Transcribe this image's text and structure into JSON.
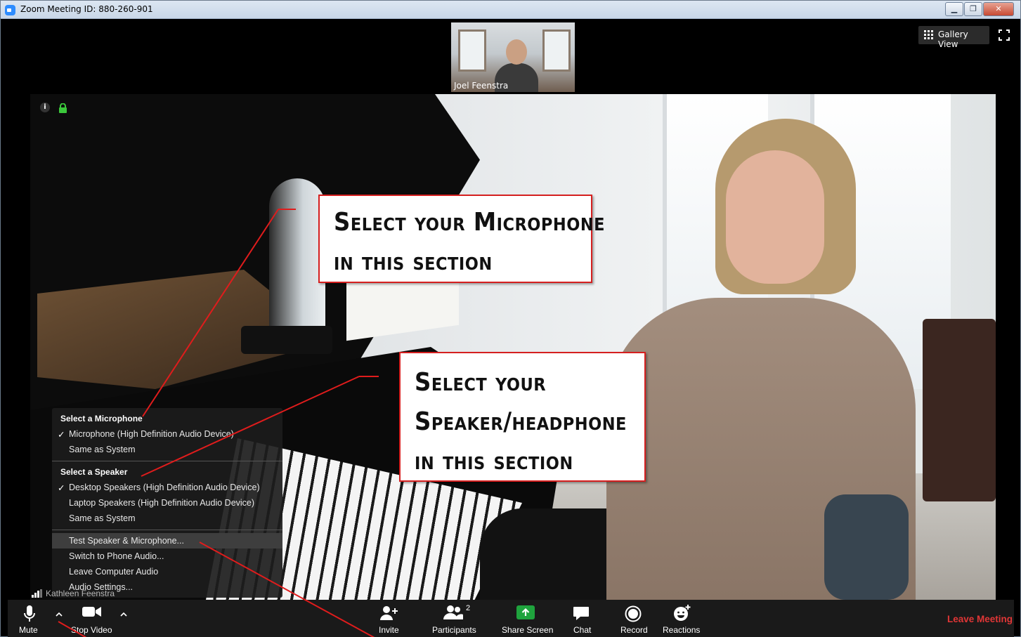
{
  "window": {
    "title": "Zoom Meeting ID: 880-260-901"
  },
  "top_bar": {
    "thumbnail_name": "Joel Feenstra",
    "gallery_label": "Gallery View"
  },
  "audio_menu": {
    "mic_heading": "Select a Microphone",
    "mic_items": [
      "Microphone (High Definition Audio Device)",
      "Same as System"
    ],
    "mic_selected": 0,
    "speaker_heading": "Select a Speaker",
    "speaker_items": [
      "Desktop Speakers (High Definition Audio Device)",
      "Laptop Speakers (High Definition Audio Device)",
      "Same as System"
    ],
    "speaker_selected": 0,
    "actions": [
      "Test Speaker & Microphone...",
      "Switch to Phone Audio...",
      "Leave Computer Audio",
      "Audio Settings..."
    ]
  },
  "main_video": {
    "participant_name": "Kathleen Feenstra"
  },
  "callouts": {
    "mic": [
      "Select your Microphone",
      "in this section"
    ],
    "speaker": [
      "Select your",
      "Speaker/headphone",
      "in this section"
    ]
  },
  "toolbar": {
    "mute": "Mute",
    "stop_video": "Stop Video",
    "invite": "Invite",
    "participants": "Participants",
    "participants_count": "2",
    "share_screen": "Share Screen",
    "chat": "Chat",
    "record": "Record",
    "reactions": "Reactions",
    "leave": "Leave Meeting"
  },
  "colors": {
    "accent_red": "#d51f1f",
    "leave_red": "#e13636",
    "share_green": "#1fa33d",
    "zoom_blue": "#2d8cff"
  }
}
